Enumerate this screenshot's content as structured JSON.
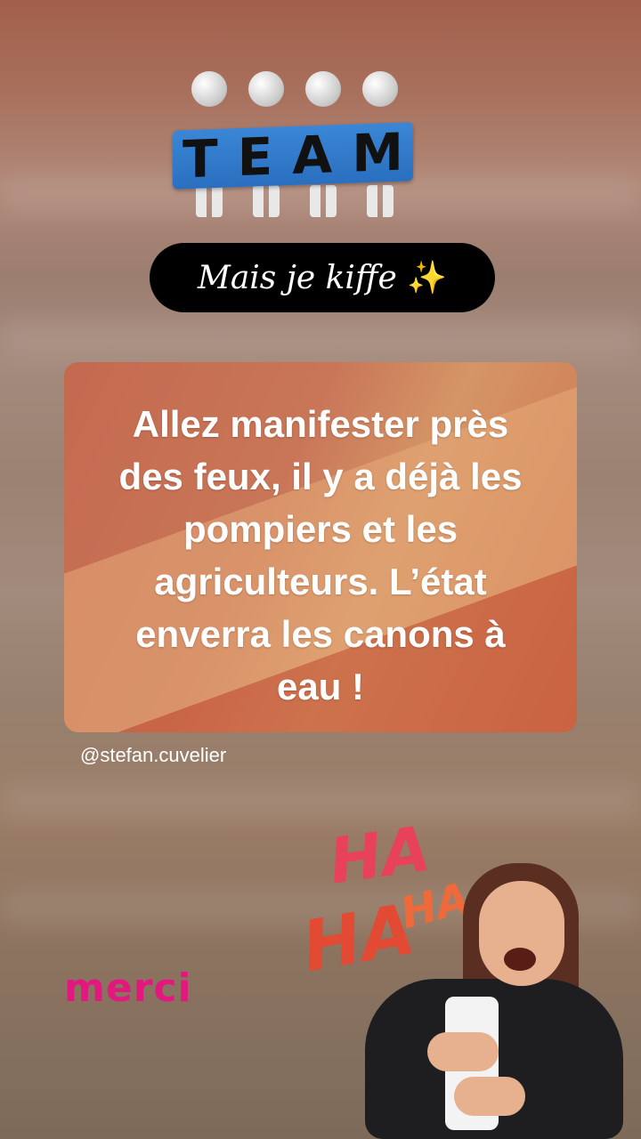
{
  "sticker_team": {
    "letters": [
      "T",
      "E",
      "A",
      "M"
    ],
    "icon": "team-figures-icon"
  },
  "pill": {
    "text": "Mais je kiffe",
    "emoji": "✨"
  },
  "card": {
    "lines": [
      "Allez manifester près",
      "des feux, il y a déjà les",
      "pompiers et les",
      "agriculteurs. L’état",
      "enverra les canons à",
      "eau !"
    ]
  },
  "handle": "@stefan.cuvelier",
  "merci": "merci",
  "haha": {
    "words": [
      "HA",
      "HA",
      "HA"
    ]
  },
  "colors": {
    "merci": "#e2187f",
    "pill_bg": "#000000",
    "banner": "#2f78cc",
    "haha": "#e84b3a"
  }
}
